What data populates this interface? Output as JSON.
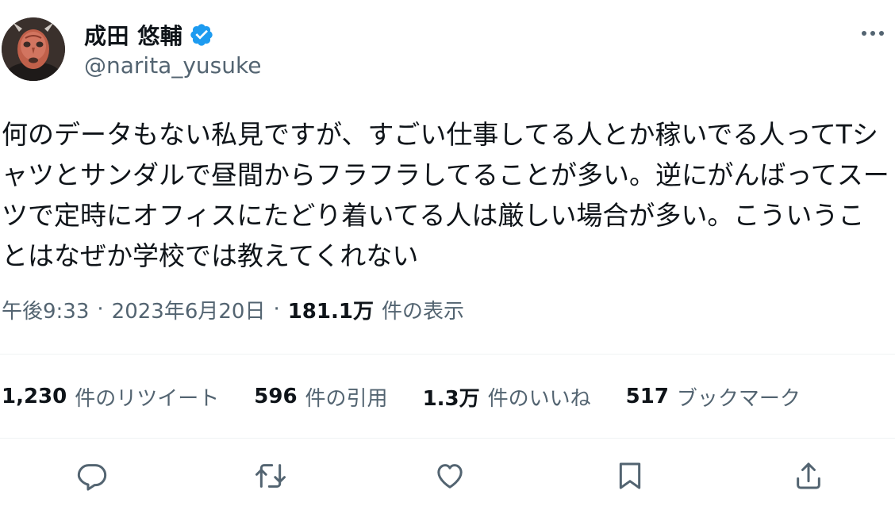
{
  "author": {
    "display_name": "成田 悠輔",
    "handle": "@narita_yusuke",
    "verified": true
  },
  "tweet": {
    "text": "何のデータもない私見ですが、すごい仕事してる人とか稼いでる人ってTシャツとサンダルで昼間からフラフラしてることが多い。逆にがんばってスーツで定時にオフィスにたどり着いてる人は厳しい場合が多い。こういうことはなぜか学校では教えてくれない"
  },
  "meta": {
    "time": "午後9:33",
    "separator": "·",
    "date": "2023年6月20日",
    "views_count": "181.1万",
    "views_label": "件の表示"
  },
  "stats": {
    "retweets": {
      "count": "1,230",
      "label": "件のリツイート"
    },
    "quotes": {
      "count": "596",
      "label": "件の引用"
    },
    "likes": {
      "count": "1.3万",
      "label": "件のいいね"
    },
    "bookmarks": {
      "count": "517",
      "label": "ブックマーク"
    }
  },
  "icons": {
    "more": "more-horizontal-icon",
    "verified": "verified-badge-icon",
    "reply": "reply-icon",
    "retweet": "retweet-icon",
    "like": "heart-icon",
    "bookmark": "bookmark-icon",
    "share": "share-icon"
  },
  "colors": {
    "text_primary": "#0f1419",
    "text_secondary": "#536471",
    "verified_blue": "#1d9bf0",
    "divider": "#eff3f4"
  }
}
